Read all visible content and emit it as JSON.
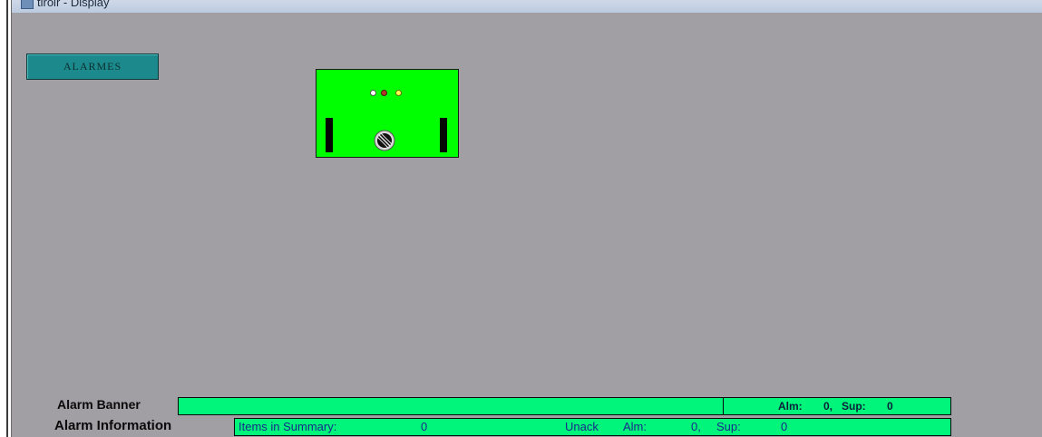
{
  "window": {
    "title": "tiroir - Display"
  },
  "display": {
    "alarmes_button_label": "ALARMES"
  },
  "footer": {
    "alarm_banner_label": "Alarm Banner",
    "alarm_banner_status": {
      "alm_label": "Alm:",
      "alm_value": "0,",
      "sup_label": "Sup:",
      "sup_value": "0"
    },
    "alarm_information_label": "Alarm Information",
    "alarm_information": {
      "items_label": "Items in Summary:",
      "items_value": "0",
      "unack_label": "Unack",
      "alm_label": "Alm:",
      "alm_value": "0,",
      "sup_label": "Sup:",
      "sup_value": "0"
    }
  },
  "colors": {
    "display_background": "#a19fa3",
    "panel_green": "#00ff00",
    "alarm_field_green": "#00f57a",
    "button_teal": "#1c8a8c"
  },
  "icons": {
    "indicators": [
      "white-indicator-light",
      "red-indicator-light",
      "yellow-indicator-light"
    ],
    "knob": "rotary-selector-knob-icon"
  }
}
